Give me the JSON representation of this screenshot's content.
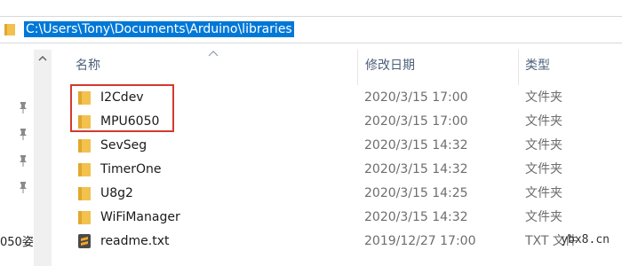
{
  "address_bar": {
    "path": "C:\\Users\\Tony\\Documents\\Arduino\\libraries"
  },
  "columns": {
    "name": "名称",
    "date": "修改日期",
    "type": "类型"
  },
  "nav_pane": {
    "partial_item": "050姿"
  },
  "rows": [
    {
      "icon": "folder-icon",
      "name": "I2Cdev",
      "date": "2020/3/15 17:00",
      "type": "文件夹"
    },
    {
      "icon": "folder-icon",
      "name": "MPU6050",
      "date": "2020/3/15 17:00",
      "type": "文件夹"
    },
    {
      "icon": "folder-icon",
      "name": "SevSeg",
      "date": "2020/3/15 14:32",
      "type": "文件夹"
    },
    {
      "icon": "folder-icon",
      "name": "TimerOne",
      "date": "2020/3/15 14:32",
      "type": "文件夹"
    },
    {
      "icon": "folder-icon",
      "name": "U8g2",
      "date": "2020/3/15 14:25",
      "type": "文件夹"
    },
    {
      "icon": "folder-icon",
      "name": "WiFiManager",
      "date": "2020/3/15 14:32",
      "type": "文件夹"
    },
    {
      "icon": "sublime-text-file-icon",
      "name": "readme.txt",
      "date": "2019/12/27 17:00",
      "type": "TXT 文件"
    }
  ],
  "watermark": "ybx8.cn",
  "colors": {
    "selection": "#0078d7",
    "folder": "#f2c14e",
    "highlight_box": "#d13b2f",
    "header_text": "#4c607a"
  }
}
